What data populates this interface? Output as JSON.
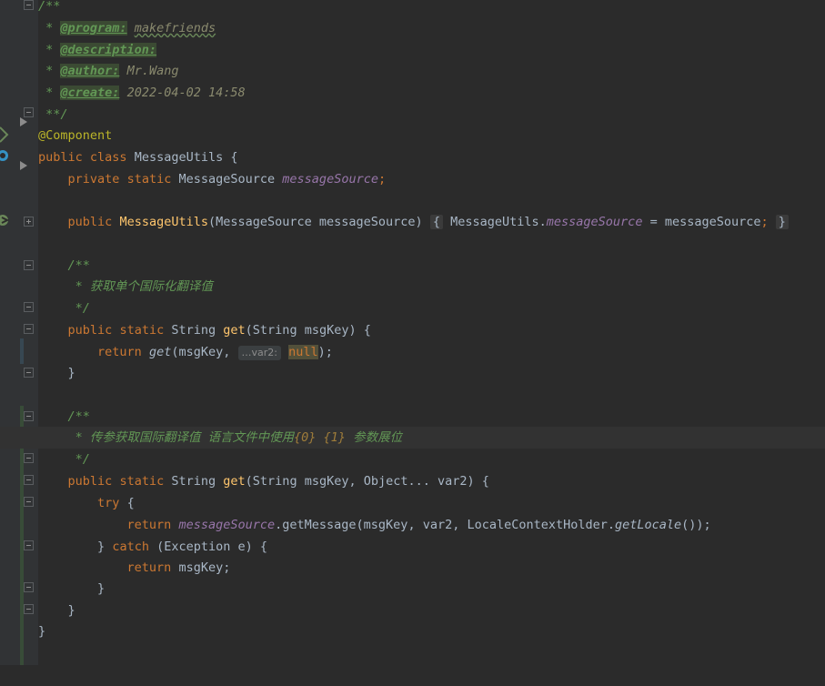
{
  "doc_header": {
    "open": "/**",
    "program_tag": "@program:",
    "program_val": "makefriends",
    "description_tag": "@description:",
    "author_tag": "@author:",
    "author_val": "Mr.Wang",
    "create_tag": "@create:",
    "create_val": "2022-04-02 14:58",
    "close": "**/"
  },
  "annotation": "@Component",
  "class_decl": {
    "kw1": "public",
    "kw2": "class",
    "name": "MessageUtils",
    "brace": "{"
  },
  "field_decl": {
    "kw1": "private",
    "kw2": "static",
    "type": "MessageSource",
    "name": "messageSource",
    "semi": ";"
  },
  "ctor": {
    "kw": "public",
    "name": "MessageUtils",
    "params": "(MessageSource messageSource)",
    "body_open": "{",
    "body_cls": "MessageUtils.",
    "body_field": "messageSource",
    "body_assign": " = messageSource",
    "body_semi": ";",
    "body_close": "}"
  },
  "doc1": {
    "open": "/**",
    "line": " * 获取单个国际化翻译值",
    "close": " */"
  },
  "method1": {
    "kw1": "public",
    "kw2": "static",
    "ret": "String",
    "name": "get",
    "params": "(String msgKey)",
    "brace": "{",
    "ret_kw": "return",
    "call": "get",
    "args": "(msgKey,",
    "hint": "…var2:",
    "null": "null",
    "tail": ");",
    "close": "}"
  },
  "doc2": {
    "open": "/**",
    "line_a": " * 传参获取国际翻译值 语言文件中使用",
    "line_b": "{0} {1}",
    "line_c": " 参数展位",
    "close": " */"
  },
  "method2": {
    "kw1": "public",
    "kw2": "static",
    "ret": "String",
    "name": "get",
    "params": "(String msgKey, Object... var2)",
    "brace": "{",
    "try_kw": "try",
    "try_brace": "{",
    "ret_kw": "return",
    "field": "messageSource",
    "call": ".getMessage(msgKey, var2, LocaleContextHolder.",
    "locale": "getLocale",
    "call_tail": "());",
    "catch_pre": "}",
    "catch_kw": "catch",
    "catch_sig": "(Exception e) {",
    "ret2_kw": "return",
    "ret2_val": "msgKey;",
    "inner_close": "}",
    "close": "}"
  },
  "class_close": "}",
  "colors": {
    "background": "#2b2b2b",
    "gutter": "#313335",
    "keyword": "#cc7832",
    "method": "#ffc66d",
    "field": "#9876aa",
    "doc": "#629755",
    "annotation": "#bbb529"
  }
}
